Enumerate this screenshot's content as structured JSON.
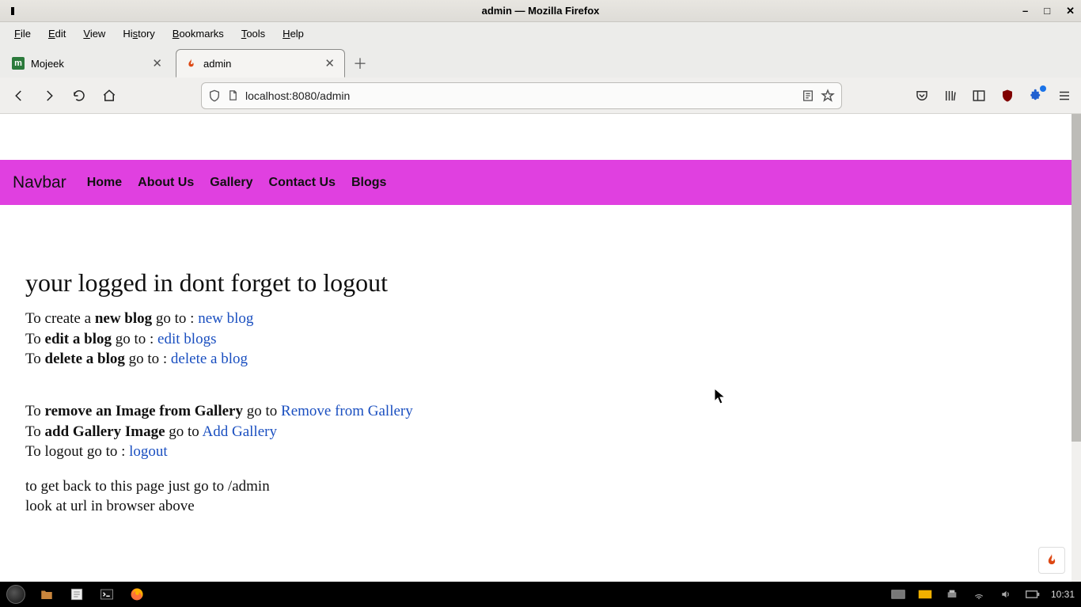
{
  "window": {
    "title": "admin — Mozilla Firefox",
    "controls": {
      "min": "–",
      "max": "□",
      "close": "✕"
    }
  },
  "menubar": [
    "File",
    "Edit",
    "View",
    "History",
    "Bookmarks",
    "Tools",
    "Help"
  ],
  "tabs": [
    {
      "label": "Mojeek",
      "active": false
    },
    {
      "label": "admin",
      "active": true
    }
  ],
  "toolbar": {
    "url": "localhost:8080/admin"
  },
  "site_navbar": {
    "brand": "Navbar",
    "links": [
      "Home",
      "About Us",
      "Gallery",
      "Contact Us",
      "Blogs"
    ]
  },
  "content": {
    "heading": "your logged in dont forget to logout",
    "lines": [
      {
        "pre": "To create a ",
        "bold": "new blog",
        "mid": " go to : ",
        "link": "new blog"
      },
      {
        "pre": "To ",
        "bold": "edit a blog",
        "mid": " go to : ",
        "link": "edit blogs"
      },
      {
        "pre": "To ",
        "bold": "delete a blog",
        "mid": " go to : ",
        "link": "delete a blog"
      }
    ],
    "lines2": [
      {
        "pre": "To ",
        "bold": "remove an Image from Gallery",
        "mid": " go to ",
        "link": "Remove from Gallery"
      },
      {
        "pre": "To ",
        "bold": "add Gallery Image",
        "mid": " go to ",
        "link": "Add Gallery"
      },
      {
        "pre": "To logout go to : ",
        "bold": "",
        "mid": "",
        "link": "logout"
      }
    ],
    "footer1": "to get back to this page just go to /admin",
    "footer2": "look at url in browser above"
  },
  "taskbar": {
    "clock": "10:31"
  }
}
